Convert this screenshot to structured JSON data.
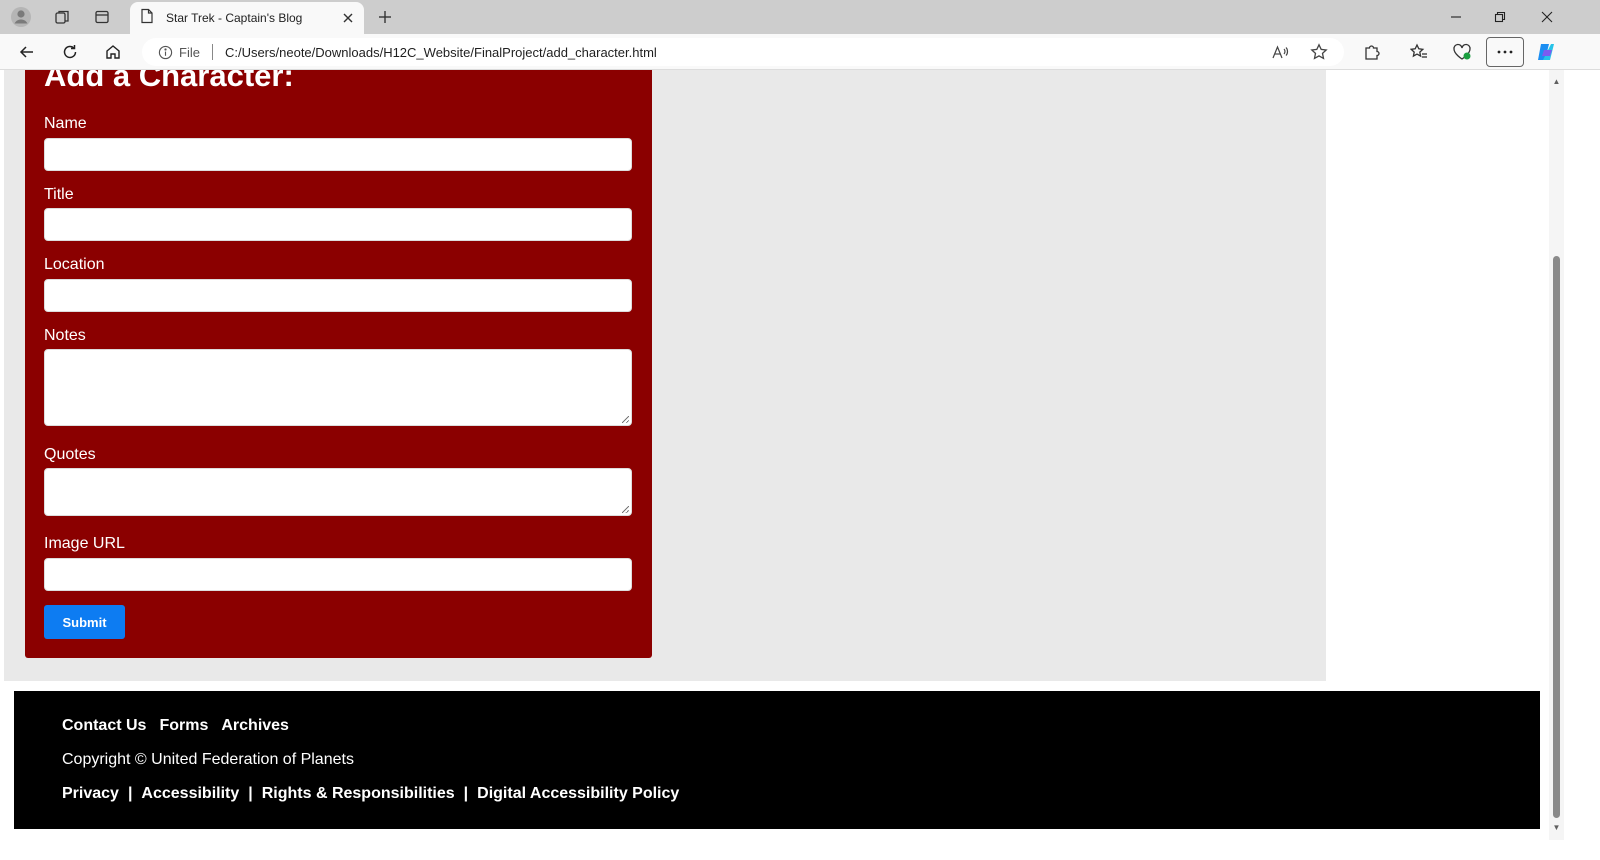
{
  "browser": {
    "tab_title": "Star Trek - Captain's Blog",
    "address_prefix": "File",
    "url": "C:/Users/neote/Downloads/H12C_Website/FinalProject/add_character.html"
  },
  "form": {
    "heading": "Add a Character:",
    "fields": [
      {
        "label": "Name",
        "value": ""
      },
      {
        "label": "Title",
        "value": ""
      },
      {
        "label": "Location",
        "value": ""
      },
      {
        "label": "Notes",
        "value": ""
      },
      {
        "label": "Quotes",
        "value": ""
      },
      {
        "label": "Image URL",
        "value": ""
      }
    ],
    "submit_label": "Submit"
  },
  "footer": {
    "nav": [
      "Contact Us",
      "Forms",
      "Archives"
    ],
    "copyright": "Copyright © United Federation of Planets",
    "policy_links": [
      "Privacy",
      "Accessibility",
      "Rights & Responsibilities",
      "Digital Accessibility Policy"
    ],
    "separator": "|"
  },
  "colors": {
    "form_background": "#8b0000",
    "submit_button": "#0d7cf2",
    "footer_background": "#000000",
    "page_background": "#e9e9e9"
  }
}
